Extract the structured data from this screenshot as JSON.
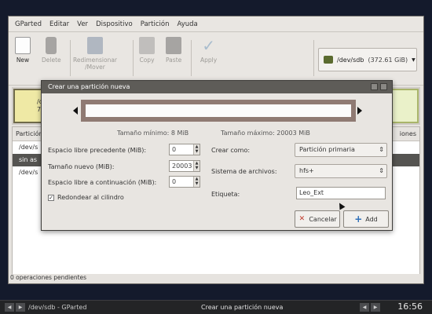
{
  "menubar": {
    "items": [
      "GParted",
      "Editar",
      "Ver",
      "Dispositivo",
      "Partición",
      "Ayuda"
    ]
  },
  "toolbar": {
    "new_label": "New",
    "delete_label": "Delete",
    "resize_label_line1": "Redimensionar",
    "resize_label_line2": "/Mover",
    "copy_label": "Copy",
    "paste_label": "Paste",
    "apply_label": "Apply"
  },
  "device": {
    "path": "/dev/sdb",
    "size": "(372.61 GiB)"
  },
  "disk_map": {
    "line1": "/de",
    "line2": "7"
  },
  "list": {
    "header_left": "Partición",
    "header_right": "iones",
    "rows": [
      "/dev/s",
      "sin as",
      "/dev/s"
    ]
  },
  "status": {
    "text": "0 operaciones pendientes"
  },
  "dialog": {
    "title": "Crear una partición nueva",
    "min_size": "Tamaño mínimo: 8 MiB",
    "max_size": "Tamaño máximo: 20003 MiB",
    "free_before_label": "Espacio libre precedente (MiB):",
    "free_before_value": "0",
    "new_size_label": "Tamaño nuevo (MiB):",
    "new_size_value": "20003",
    "free_after_label": "Espacio libre a continuación (MiB):",
    "free_after_value": "0",
    "round_label": "Redondear al cilindro",
    "create_as_label": "Crear como:",
    "create_as_value": "Partición primaria",
    "filesystem_label": "Sistema de archivos:",
    "filesystem_value": "hfs+",
    "label_label": "Etiqueta:",
    "label_value": "Leo_Ext",
    "cancel_label": "Cancelar",
    "add_label": "Add"
  },
  "taskbar": {
    "window_task": "/dev/sdb - GParted",
    "dialog_task": "Crear una partición nueva",
    "clock": "16:56"
  },
  "colors": {
    "primary_fill": "#efe9a5",
    "extended_fill": "#eaf1c9",
    "unallocated": "#a8a8a8",
    "resizer_border": "#8f7a73"
  }
}
